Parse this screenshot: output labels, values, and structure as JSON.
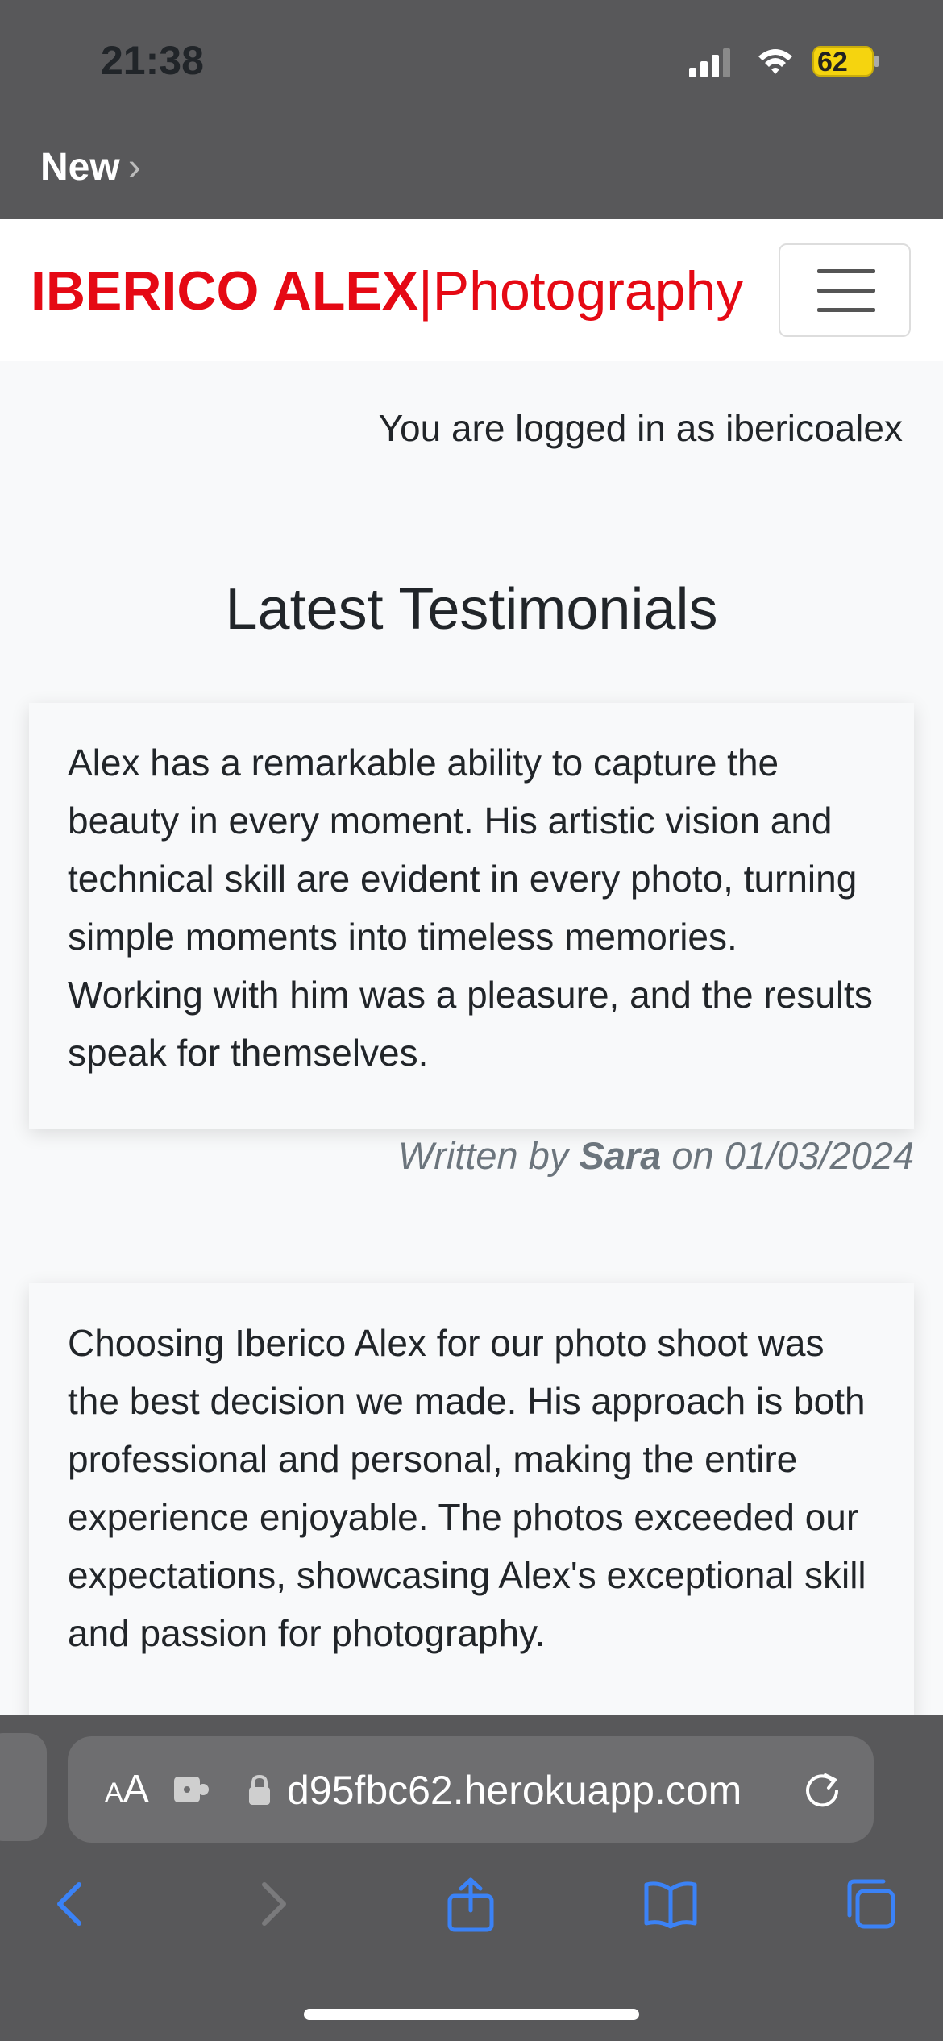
{
  "status": {
    "time": "21:38",
    "battery": "62"
  },
  "nav_back": {
    "label": "New"
  },
  "brand": {
    "name_bold": "IBERICO ALEX",
    "separator": "|",
    "name_thin": "Photography",
    "color": "#e50914"
  },
  "login_text": "You are logged in as ibericoalex",
  "page_title": "Latest Testimonials",
  "testimonials": [
    {
      "text": "Alex has a remarkable ability to capture the beauty in every moment. His artistic vision and technical skill are evident in every photo, turning simple moments into timeless memories. Working with him was a pleasure, and the results speak for themselves.",
      "byline_prefix": "Written by",
      "author": "Sara",
      "date_prefix": "on",
      "date": "01/03/2024"
    },
    {
      "text": "Choosing Iberico Alex for our photo shoot was the best decision we made. His approach is both professional and personal, making the entire experience enjoyable. The photos exceeded our expectations, showcasing Alex's exceptional skill and passion for photography."
    }
  ],
  "browser": {
    "aa_small": "A",
    "aa_large": "A",
    "url": "d95fbc62.herokuapp.com",
    "accent": "#3b82f6"
  }
}
